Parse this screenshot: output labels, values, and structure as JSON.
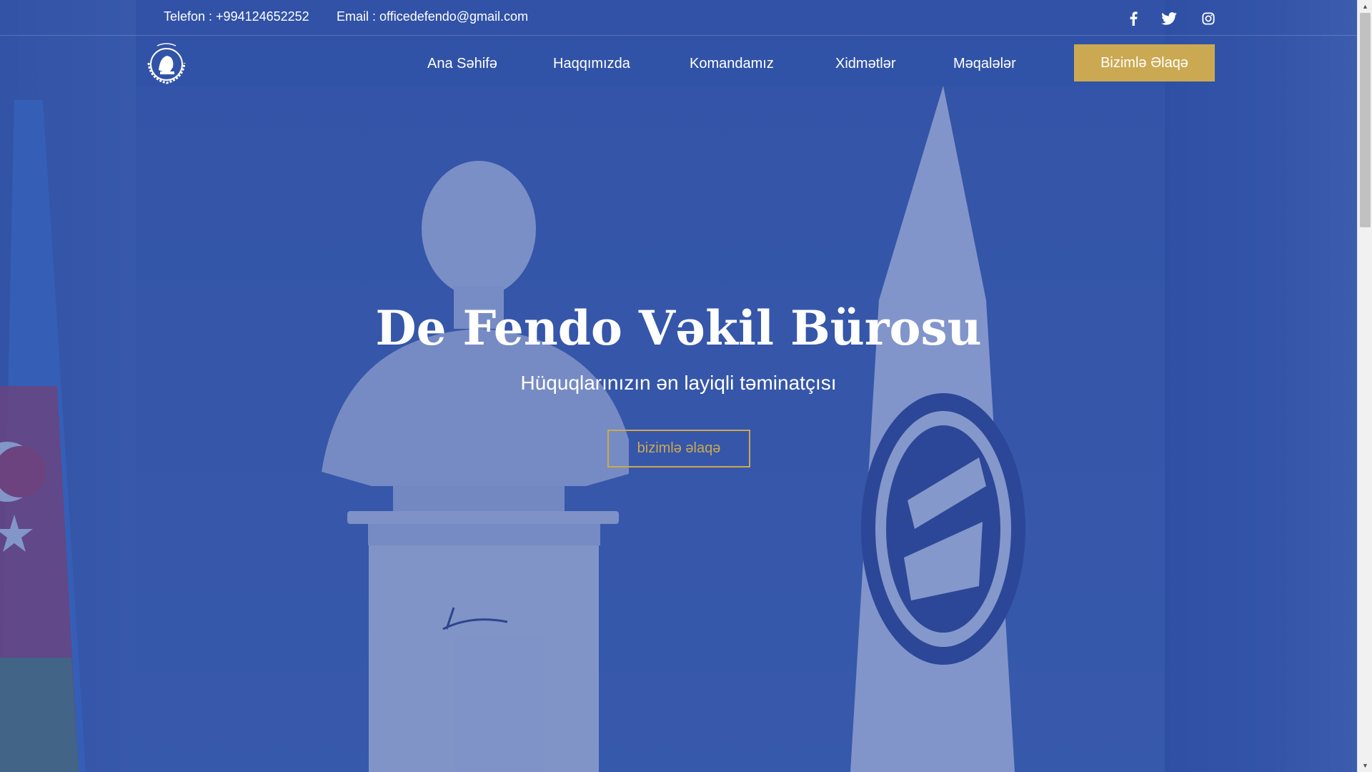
{
  "topbar": {
    "phone": "Telefon : +994124652252",
    "email": "Email : officedefendo@gmail.com",
    "social": [
      "facebook-icon",
      "twitter-icon",
      "instagram-icon"
    ]
  },
  "nav": {
    "items": [
      {
        "label": "Ana Səhifə"
      },
      {
        "label": "Haqqımızda"
      },
      {
        "label": "Komandamız"
      },
      {
        "label": "Xidmətlər"
      },
      {
        "label": "Məqalələr"
      }
    ],
    "cta_label": "Bizimlə Əlaqə"
  },
  "hero": {
    "title": "De Fendo Vəkil Bürosu",
    "subtitle": "Hüquqlarınızın ən layiqli təminatçısı",
    "button_label": "bizimlə əlaqə"
  },
  "colors": {
    "primary_blue": "#2f4f9f",
    "accent_gold": "#cba952",
    "text": "#ffffff"
  }
}
